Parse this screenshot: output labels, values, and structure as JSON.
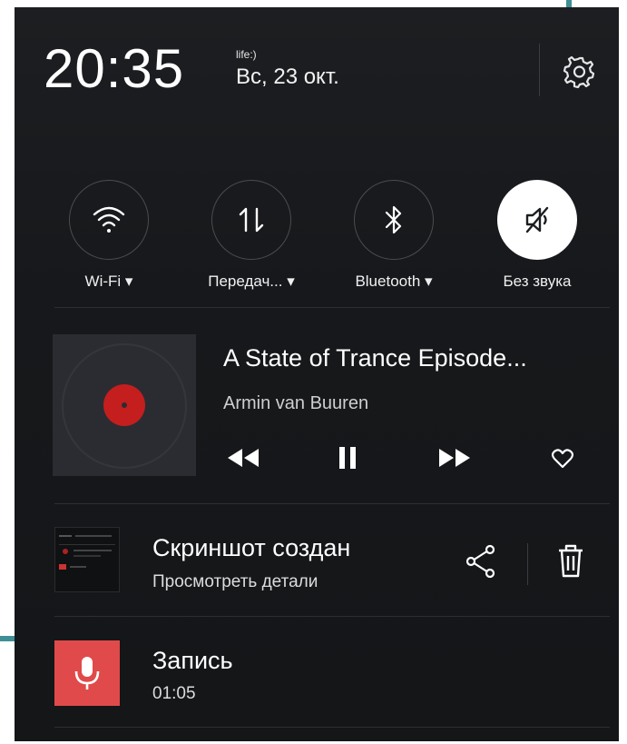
{
  "status": {
    "time": "20:35",
    "carrier": "life:)",
    "date": "Вс, 23 окт."
  },
  "quick_toggles": [
    {
      "label": "Wi-Fi",
      "icon": "wifi-icon",
      "active": false,
      "has_dropdown": true
    },
    {
      "label": "Передач...",
      "icon": "data-transfer-icon",
      "active": false,
      "has_dropdown": true
    },
    {
      "label": "Bluetooth",
      "icon": "bluetooth-icon",
      "active": false,
      "has_dropdown": true
    },
    {
      "label": "Без звука",
      "icon": "mute-icon",
      "active": true,
      "has_dropdown": false
    }
  ],
  "media": {
    "title": "A State of Trance Episode...",
    "artist": "Armin van Buuren",
    "accent": "#c41e1e"
  },
  "notifications": [
    {
      "title": "Скриншот создан",
      "subtitle": "Просмотреть детали"
    },
    {
      "title": "Запись",
      "subtitle": "01:05",
      "accent": "#e14a4a"
    }
  ],
  "colors": {
    "panel": "#1a1c1f",
    "frame_accent": "#3f8f95"
  }
}
